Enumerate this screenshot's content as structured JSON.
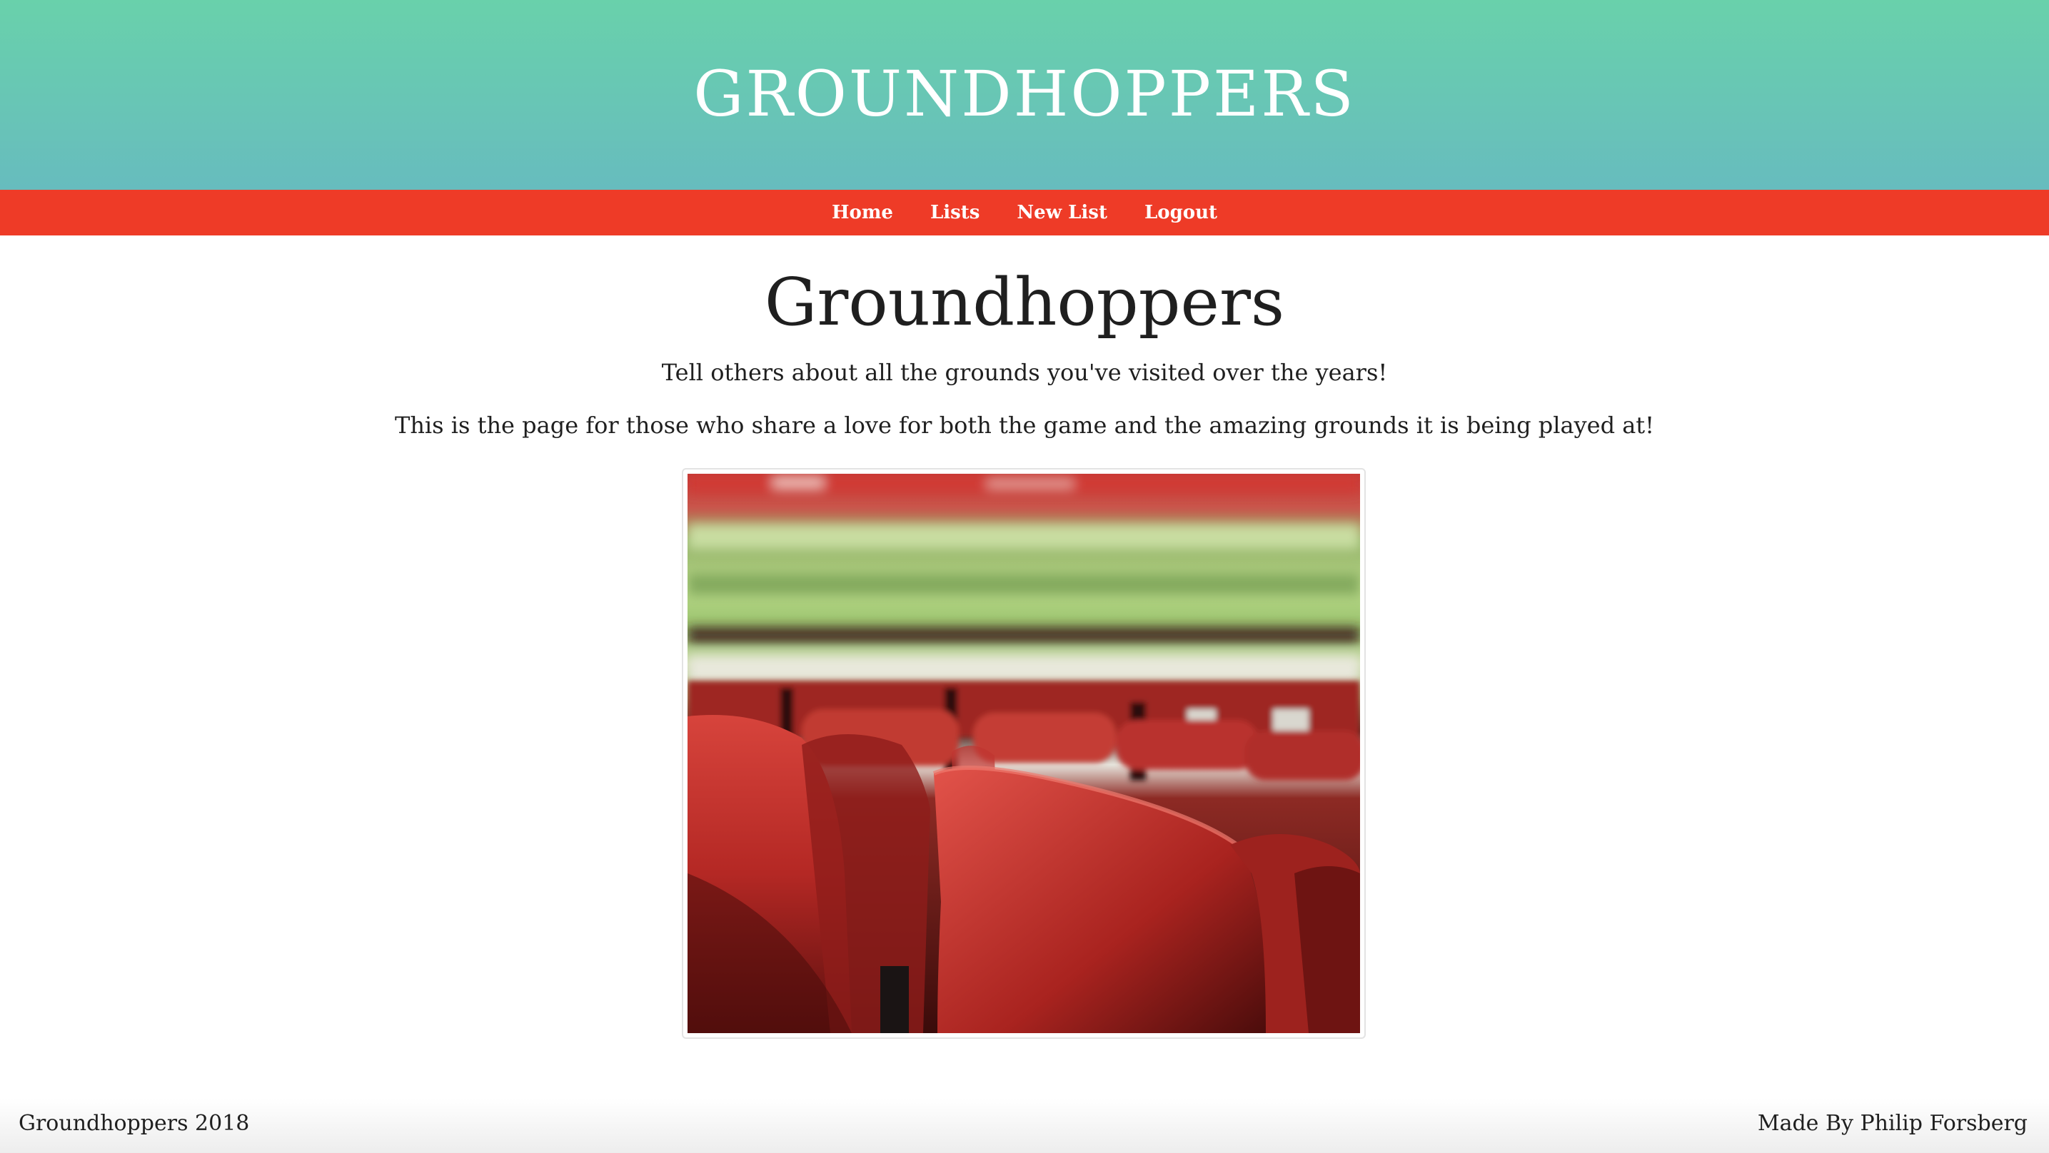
{
  "header": {
    "site_title": "GROUNDHOPPERS"
  },
  "nav": {
    "items": [
      {
        "label": "Home"
      },
      {
        "label": "Lists"
      },
      {
        "label": "New List"
      },
      {
        "label": "Logout"
      }
    ]
  },
  "main": {
    "heading": "Groundhoppers",
    "tagline": "Tell others about all the grounds you've visited over the years!",
    "description": "This is the page for those who share a love for both the game and the amazing grounds it is being played at!",
    "image": {
      "subject": "stadium-seats-photo"
    }
  },
  "footer": {
    "left_text": "Groundhoppers 2018",
    "right_text": "Made By Philip Forsberg"
  },
  "colors": {
    "header_gradient_top": "#69d1ab",
    "header_gradient_bottom": "#67bcbe",
    "nav_background": "#ee3b27",
    "text": "#1f1f1f"
  }
}
